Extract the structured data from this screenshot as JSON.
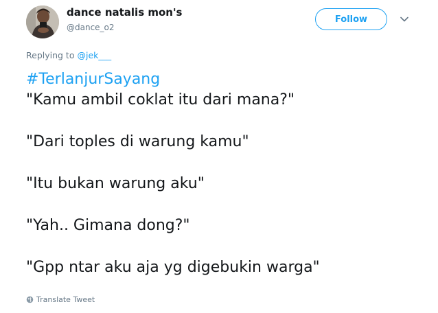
{
  "tweet_header": {
    "display_name": "dance natalis mon's",
    "handle": "@dance_o2",
    "follow_label": "Follow"
  },
  "reply": {
    "prefix": "Replying to",
    "to_handle": "@jek___"
  },
  "tweet": {
    "hashtag": "#TerlanjurSayang",
    "lines": [
      "\"Kamu ambil coklat itu dari mana?\"",
      "\"Dari toples di warung kamu\"",
      "\"Itu bukan warung aku\"",
      "\"Yah.. Gimana dong?\"",
      "\"Gpp ntar aku aja yg digebukin warga\""
    ]
  },
  "footer": {
    "translate_label": "Translate Tweet"
  },
  "colors": {
    "accent": "#1da1f2",
    "text": "#14171a",
    "muted": "#657786"
  },
  "icons": {
    "menu": "chevron-down-icon",
    "translate": "globe-icon"
  }
}
